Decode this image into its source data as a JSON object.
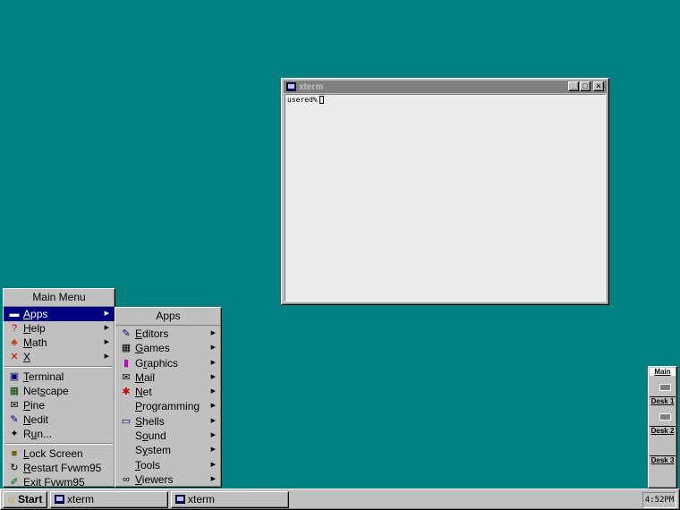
{
  "desktop": {
    "background": "#008080"
  },
  "window": {
    "title": "xterm",
    "icon": "terminal-icon",
    "buttons": [
      "_",
      "□",
      "×"
    ],
    "prompt": "usered%"
  },
  "main_menu": {
    "title": "Main Menu",
    "items": [
      {
        "icon": "apps-icon",
        "label": "Apps",
        "u": "A",
        "rest": "pps",
        "submenu": true,
        "selected": true
      },
      {
        "icon": "help-icon",
        "label": "Help",
        "u": "H",
        "rest": "elp",
        "submenu": true
      },
      {
        "icon": "math-icon",
        "label": "Math",
        "u": "M",
        "rest": "ath",
        "submenu": true
      },
      {
        "icon": "x-icon",
        "label": "X",
        "u": "X",
        "rest": "",
        "submenu": true
      },
      {
        "icon": "terminal-icon",
        "label": "Terminal",
        "u": "T",
        "rest": "erminal"
      },
      {
        "icon": "netscape-icon",
        "label": "Netscape",
        "pre": "Net",
        "u": "s",
        "rest": "cape"
      },
      {
        "icon": "mail-icon",
        "label": "Pine",
        "u": "P",
        "rest": "ine"
      },
      {
        "icon": "editor-icon",
        "label": "Nedit",
        "u": "N",
        "rest": "edit"
      },
      {
        "icon": "run-icon",
        "label": "Run...",
        "pre": "R",
        "u": "u",
        "rest": "n..."
      },
      {
        "icon": "lock-icon",
        "label": "Lock Screen",
        "u": "L",
        "rest": "ock Screen"
      },
      {
        "icon": "restart-icon",
        "label": "Restart Fvwm95",
        "u": "R",
        "rest": "estart Fvwm95"
      },
      {
        "icon": "exit-icon",
        "label": "Exit Fvwm95",
        "u": "E",
        "rest": "xit Fvwm95"
      }
    ]
  },
  "apps_menu": {
    "title": "Apps",
    "items": [
      {
        "icon": "editor-icon",
        "u": "E",
        "rest": "ditors"
      },
      {
        "icon": "games-icon",
        "u": "G",
        "rest": "ames"
      },
      {
        "icon": "graphics-icon",
        "pre": "G",
        "u": "r",
        "rest": "aphics"
      },
      {
        "icon": "mail-icon",
        "u": "M",
        "rest": "ail"
      },
      {
        "icon": "net-icon",
        "u": "N",
        "rest": "et"
      },
      {
        "icon": "",
        "u": "P",
        "rest": "rogramming"
      },
      {
        "icon": "shells-icon",
        "u": "S",
        "rest": "hells"
      },
      {
        "icon": "",
        "pre": "S",
        "u": "o",
        "rest": "und"
      },
      {
        "icon": "",
        "pre": "S",
        "u": "y",
        "rest": "stem"
      },
      {
        "icon": "",
        "u": "T",
        "rest": "ools"
      },
      {
        "icon": "viewers-icon",
        "u": "V",
        "rest": "iewers"
      }
    ]
  },
  "pager": {
    "desks": [
      {
        "label": "Main",
        "active": true,
        "has_window": true
      },
      {
        "label": "Desk 1",
        "has_window": true
      },
      {
        "label": "Desk 2",
        "has_window": false
      },
      {
        "label": "Desk 3",
        "has_window": false
      }
    ]
  },
  "taskbar": {
    "start_label": "Start",
    "tasks": [
      {
        "label": "xterm"
      },
      {
        "label": "xterm"
      }
    ],
    "clock": "4:52PM"
  }
}
